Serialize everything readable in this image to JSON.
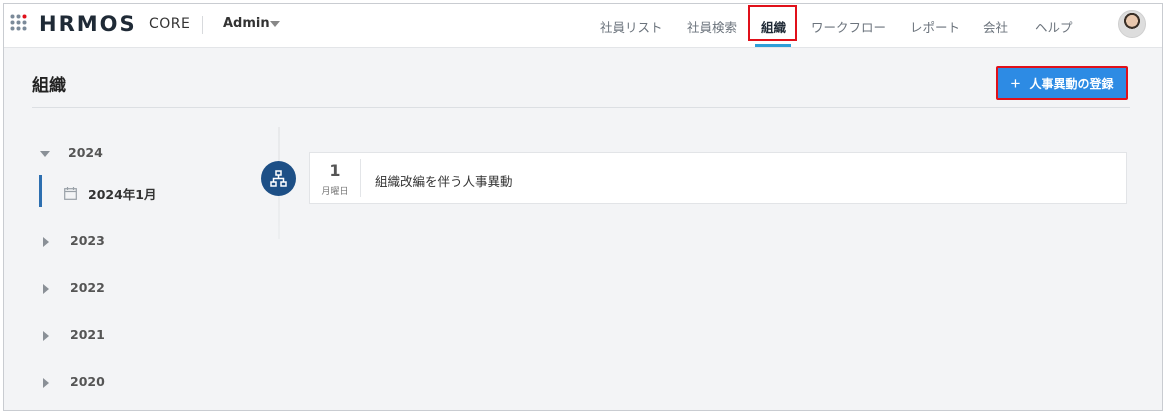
{
  "header": {
    "logo": "HRMOS",
    "product": "CORE",
    "workspace": "Admin",
    "nav": [
      "社員リスト",
      "社員検索",
      "組織",
      "ワークフロー",
      "レポート",
      "会社",
      "ヘルプ"
    ],
    "active_nav": "組織"
  },
  "page": {
    "title": "組織",
    "add_button_label": "人事異動の登録"
  },
  "tree": {
    "years": [
      "2024",
      "2023",
      "2022",
      "2021",
      "2020"
    ],
    "expanded_year": "2024",
    "selected_month": "2024年1月"
  },
  "events": [
    {
      "day": "1",
      "weekday": "月曜日",
      "title": "組織改編を伴う人事異動"
    }
  ],
  "colors": {
    "accent": "#2d8be4",
    "node": "#1d4f86",
    "highlight": "#e0101a"
  },
  "icons": {
    "app_menu": "grid-icon",
    "dropdown": "chevron-down-icon",
    "add": "plus-icon",
    "calendar": "calendar-icon",
    "org_node": "org-chart-icon"
  }
}
